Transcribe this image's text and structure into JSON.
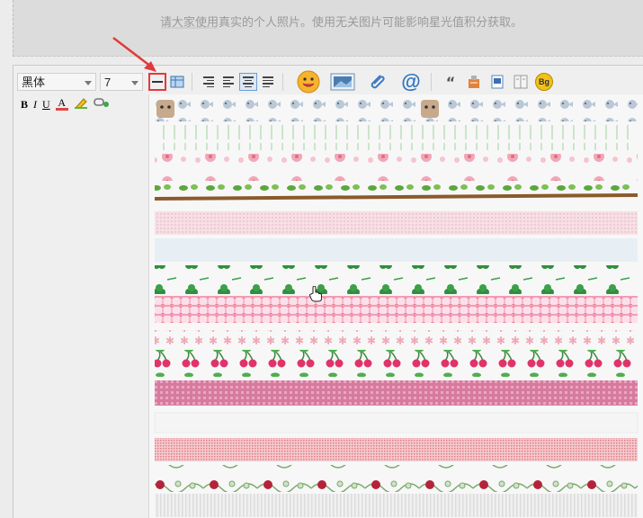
{
  "notice": {
    "text": "请大家使用真实的个人照片。使用无关图片可能影响星光值积分获取。"
  },
  "toolbar": {
    "font_family_value": "黑体",
    "font_size_value": "7",
    "bold_label": "B",
    "italic_label": "I",
    "underline_label": "U",
    "font_color_label": "A",
    "quote_label": "“",
    "bg_label": "Bg"
  },
  "colors": {
    "highlight_border": "#e23a3a",
    "arrow": "#e23a3a",
    "active_button": "#dde8f4"
  },
  "divider_panel": {
    "strips": [
      "cat-fish",
      "green-dashes",
      "pink-flowers",
      "branch-leaves",
      "pink-mesh",
      "pale-blue",
      "clover",
      "orange-checker",
      "pink-stars",
      "cherries",
      "magenta-grid",
      "blank",
      "red-mesh",
      "rose-vine",
      "gray-mesh"
    ]
  }
}
